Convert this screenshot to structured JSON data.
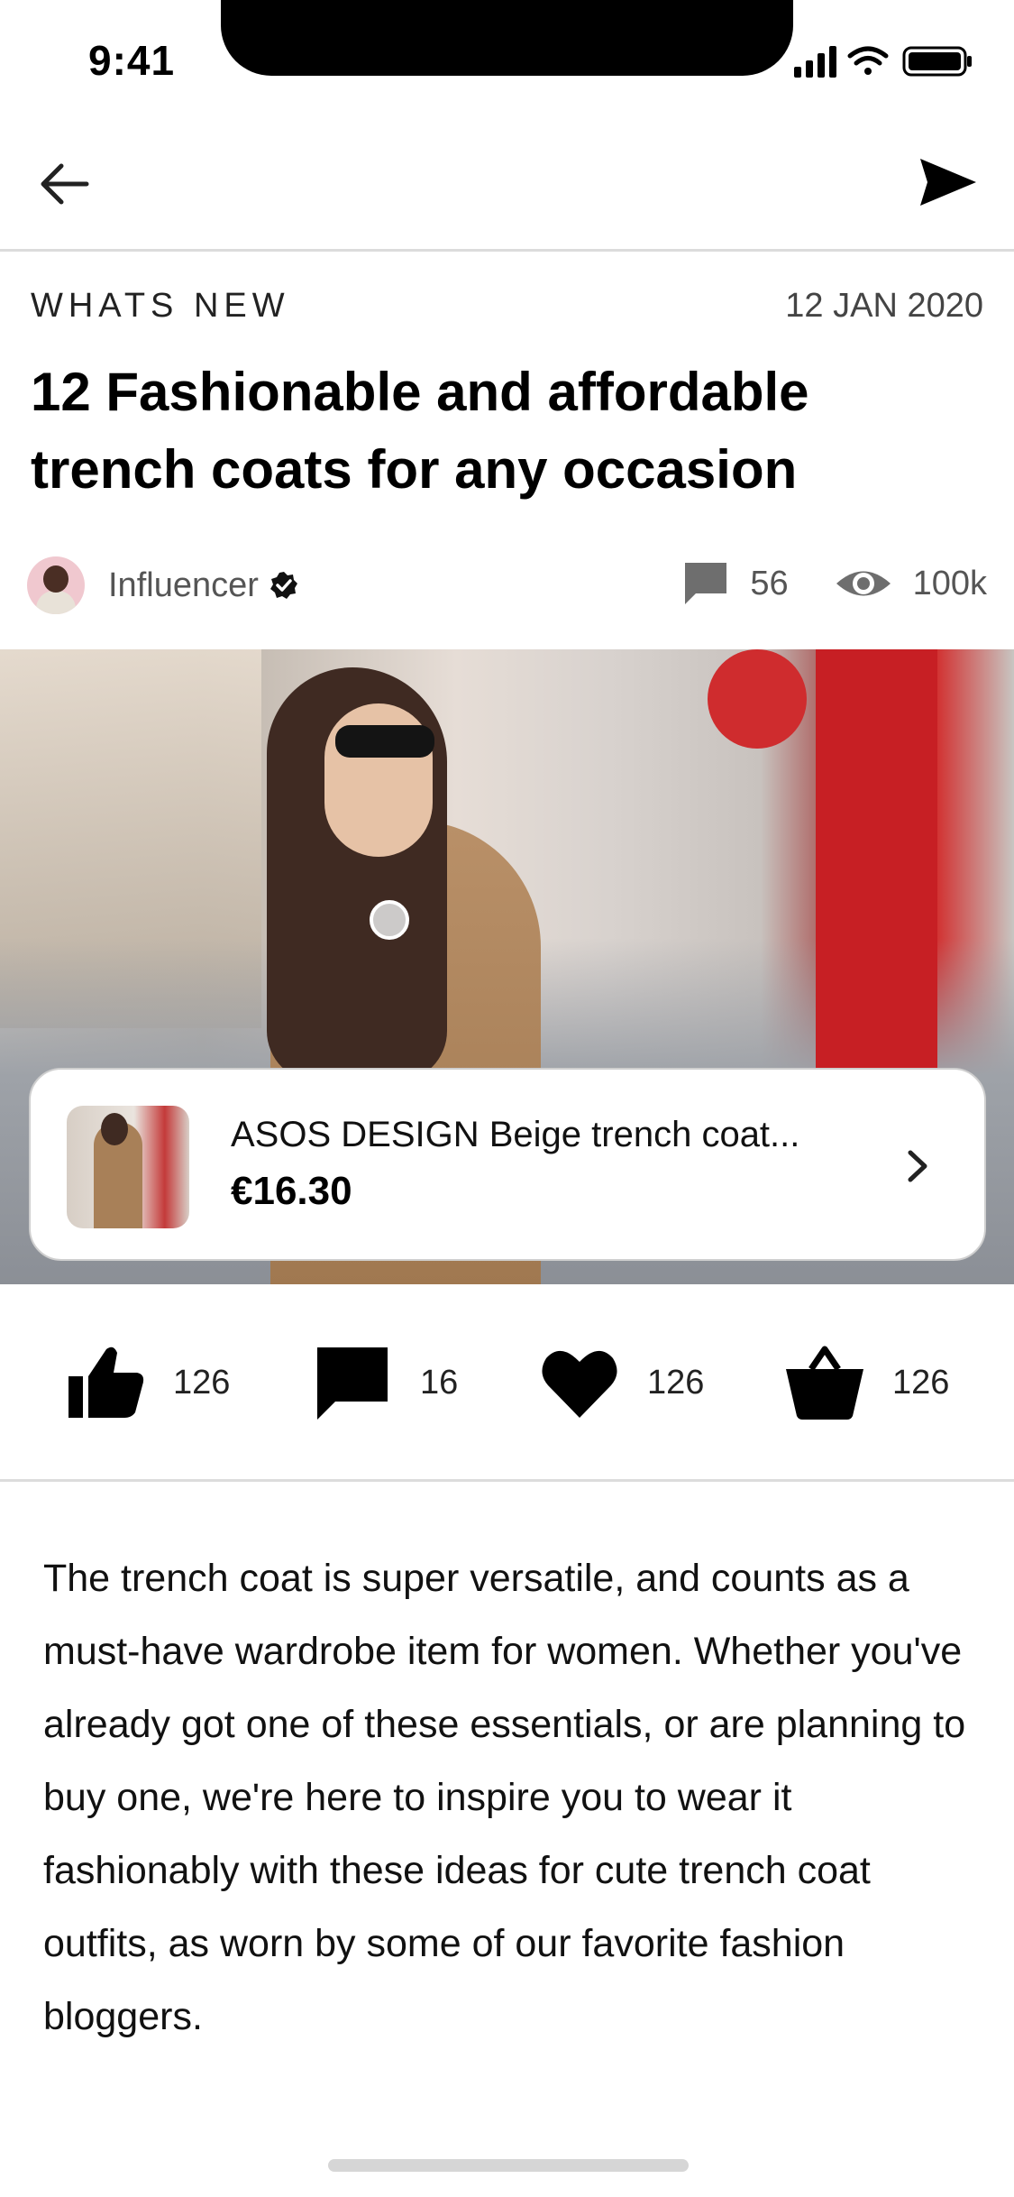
{
  "status_bar": {
    "time": "9:41"
  },
  "nav": {
    "back_icon": "arrow-left-icon",
    "share_icon": "send-icon"
  },
  "article": {
    "category": "WHATS NEW",
    "date": "12 JAN 2020",
    "title": "12 Fashionable and affordable trench coats for any occasion",
    "author": {
      "name": "Influencer",
      "verified": true
    },
    "stats": {
      "comments": "56",
      "views": "100k"
    },
    "body": "The trench coat is super versatile, and counts as a must-have wardrobe item for women. Whether you've already got one of these essentials, or are planning to buy one, we're here to inspire you to wear it fashionably with these ideas for cute trench coat outfits, as worn by some of our favorite fashion bloggers."
  },
  "product": {
    "name": "ASOS DESIGN Beige trench coat...",
    "price": "€16.30"
  },
  "actions": {
    "likes": "126",
    "comments": "16",
    "favorites": "126",
    "basket": "126"
  }
}
